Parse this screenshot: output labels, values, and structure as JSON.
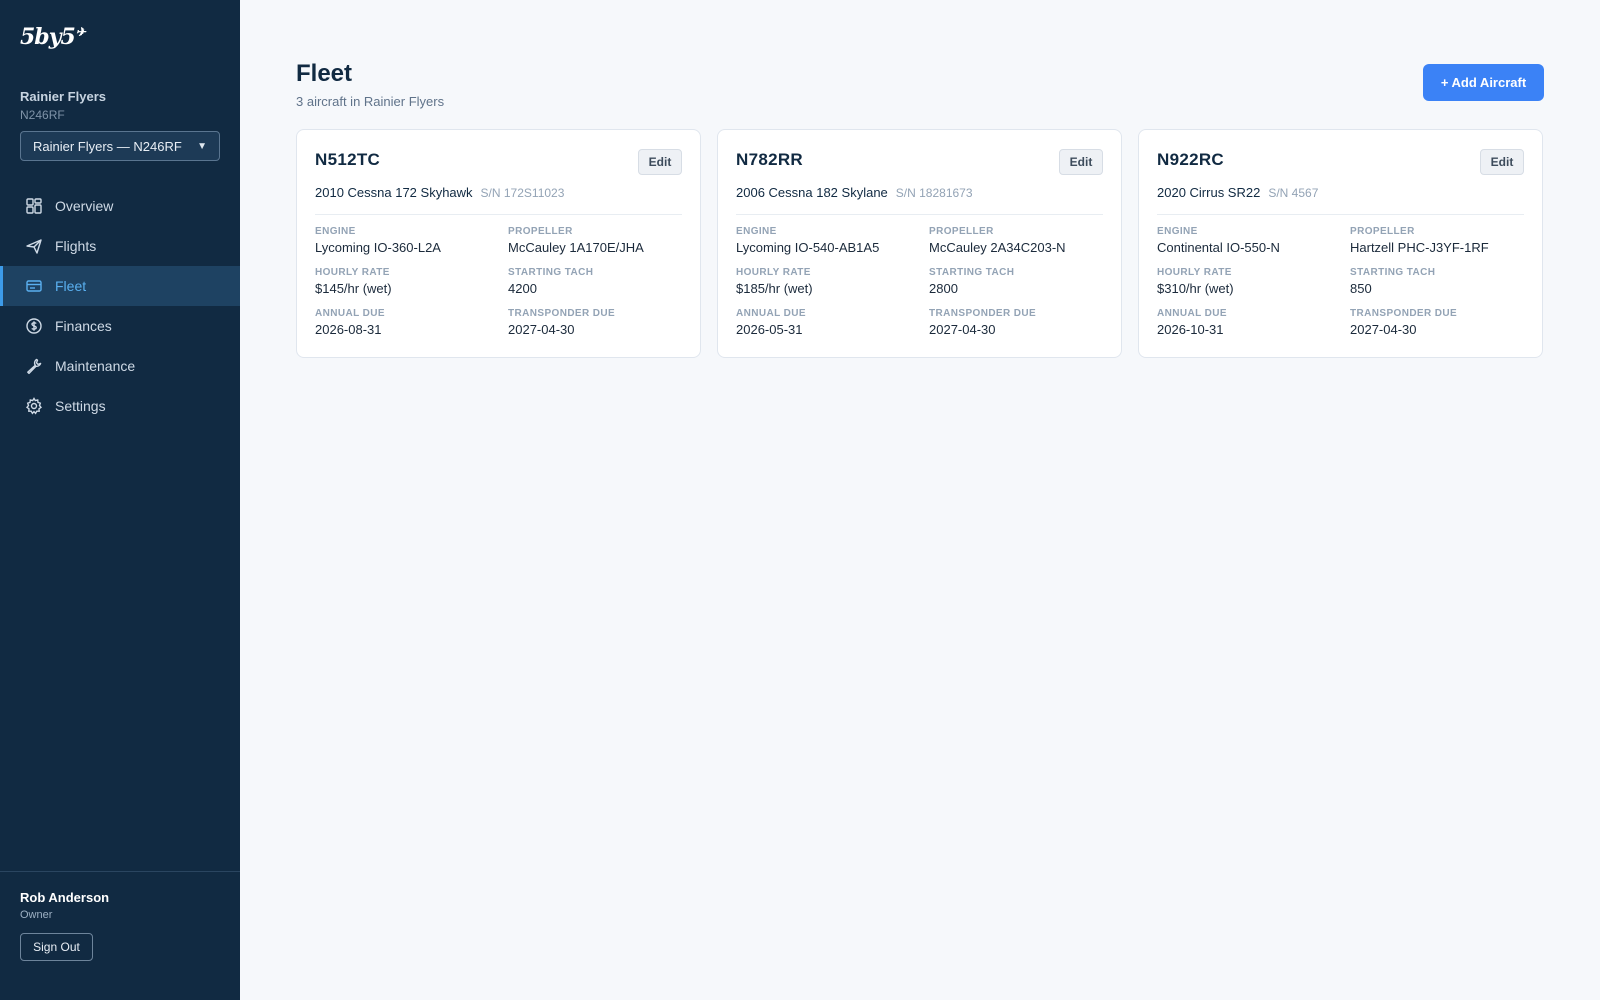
{
  "app": {
    "logo": "5by5"
  },
  "sidebar": {
    "club_name": "Rainier Flyers",
    "club_tail": "N246RF",
    "club_select": "Rainier Flyers — N246RF",
    "nav": [
      {
        "label": "Overview",
        "icon": "grid-icon"
      },
      {
        "label": "Flights",
        "icon": "plane-icon"
      },
      {
        "label": "Fleet",
        "icon": "fleet-icon",
        "active": true
      },
      {
        "label": "Finances",
        "icon": "dollar-icon"
      },
      {
        "label": "Maintenance",
        "icon": "wrench-icon"
      },
      {
        "label": "Settings",
        "icon": "gear-icon"
      }
    ],
    "user": {
      "name": "Rob Anderson",
      "role": "Owner",
      "signout": "Sign Out"
    }
  },
  "header": {
    "title": "Fleet",
    "subtitle": "3 aircraft in Rainier Flyers",
    "add_button": "+ Add Aircraft"
  },
  "labels": {
    "engine": "ENGINE",
    "propeller": "PROPELLER",
    "hourly_rate": "HOURLY RATE",
    "starting_tach": "STARTING TACH",
    "annual_due": "ANNUAL DUE",
    "transponder_due": "TRANSPONDER DUE",
    "edit": "Edit"
  },
  "aircraft": [
    {
      "tail": "N512TC",
      "model": "2010 Cessna 172 Skyhawk",
      "sn": "S/N 172S11023",
      "engine": "Lycoming IO-360-L2A",
      "propeller": "McCauley 1A170E/JHA",
      "hourly_rate": "$145/hr (wet)",
      "starting_tach": "4200",
      "annual_due": "2026-08-31",
      "transponder_due": "2027-04-30"
    },
    {
      "tail": "N782RR",
      "model": "2006 Cessna 182 Skylane",
      "sn": "S/N 18281673",
      "engine": "Lycoming IO-540-AB1A5",
      "propeller": "McCauley 2A34C203-N",
      "hourly_rate": "$185/hr (wet)",
      "starting_tach": "2800",
      "annual_due": "2026-05-31",
      "transponder_due": "2027-04-30"
    },
    {
      "tail": "N922RC",
      "model": "2020 Cirrus SR22",
      "sn": "S/N 4567",
      "engine": "Continental IO-550-N",
      "propeller": "Hartzell PHC-J3YF-1RF",
      "hourly_rate": "$310/hr (wet)",
      "starting_tach": "850",
      "annual_due": "2026-10-31",
      "transponder_due": "2027-04-30"
    }
  ],
  "colors": {
    "sidebar_bg": "#112a42",
    "accent": "#3b82f6",
    "active_nav": "#5ab0f0"
  }
}
